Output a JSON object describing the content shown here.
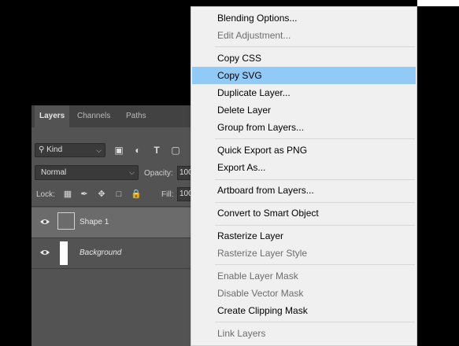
{
  "panel": {
    "tabs": [
      "Layers",
      "Channels",
      "Paths"
    ],
    "filter": {
      "kind_label": "Kind"
    },
    "blend_mode": "Normal",
    "opacity_label": "Opacity:",
    "opacity_value": "100",
    "lock_label": "Lock:",
    "fill_label": "Fill:",
    "fill_value": "100",
    "layers": [
      {
        "name": "Shape 1",
        "selected": true
      },
      {
        "name": "Background",
        "selected": false
      }
    ]
  },
  "menu": {
    "highlight_color": "#91c9f7",
    "items": [
      {
        "label": "Blending Options...",
        "disabled": false
      },
      {
        "label": "Edit Adjustment...",
        "disabled": true
      },
      {
        "label": "Copy CSS",
        "disabled": false
      },
      {
        "label": "Copy SVG",
        "disabled": false,
        "highlighted": true
      },
      {
        "label": "Duplicate Layer...",
        "disabled": false
      },
      {
        "label": "Delete Layer",
        "disabled": false
      },
      {
        "label": "Group from Layers...",
        "disabled": false
      },
      {
        "label": "Quick Export as PNG",
        "disabled": false
      },
      {
        "label": "Export As...",
        "disabled": false
      },
      {
        "label": "Artboard from Layers...",
        "disabled": false
      },
      {
        "label": "Convert to Smart Object",
        "disabled": false
      },
      {
        "label": "Rasterize Layer",
        "disabled": false
      },
      {
        "label": "Rasterize Layer Style",
        "disabled": true
      },
      {
        "label": "Enable Layer Mask",
        "disabled": true
      },
      {
        "label": "Disable Vector Mask",
        "disabled": true
      },
      {
        "label": "Create Clipping Mask",
        "disabled": false
      },
      {
        "label": "Link Layers",
        "disabled": true
      }
    ]
  }
}
